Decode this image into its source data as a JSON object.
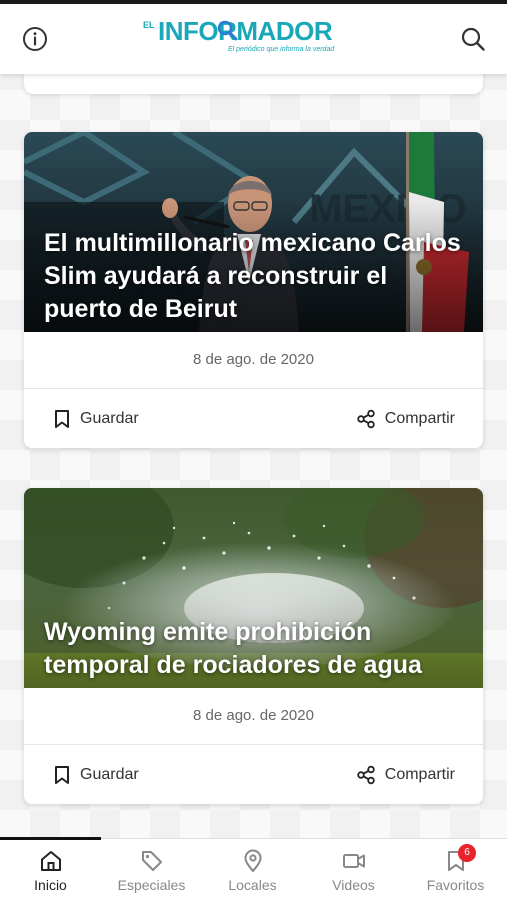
{
  "header": {
    "logo_prefix": "EL",
    "logo_name": "INFORMADOR",
    "logo_tagline": "El periódico que informa la verdad",
    "info_icon": "info-icon",
    "search_icon": "search-icon",
    "brand_color": "#1aa8b8"
  },
  "articles": [
    {
      "title": "El multimillonario mexicano Carlos Slim ayudará a reconstruir el puerto de Beirut",
      "date": "8 de ago. de 2020",
      "save_label": "Guardar",
      "share_label": "Compartir"
    },
    {
      "title": "Wyoming emite prohibición temporal de rociadores de agua",
      "date": "8 de ago. de 2020",
      "save_label": "Guardar",
      "share_label": "Compartir"
    }
  ],
  "bottom_nav": {
    "items": [
      {
        "label": "Inicio",
        "icon": "home-icon",
        "active": true
      },
      {
        "label": "Especiales",
        "icon": "tag-icon"
      },
      {
        "label": "Locales",
        "icon": "location-pin-icon"
      },
      {
        "label": "Videos",
        "icon": "video-camera-icon"
      },
      {
        "label": "Favoritos",
        "icon": "bookmark-icon",
        "badge": "6"
      }
    ],
    "badge_color": "#e8232a"
  }
}
